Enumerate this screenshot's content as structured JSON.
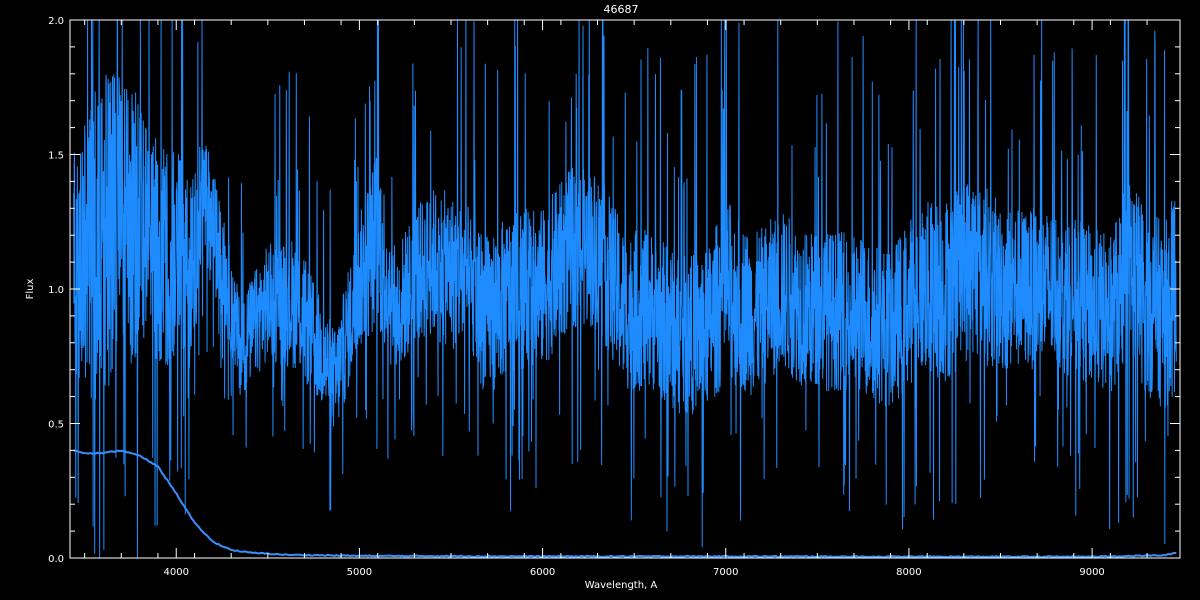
{
  "chart_data": {
    "type": "line",
    "title": "46687",
    "xlabel": "Wavelength, A",
    "ylabel": "Flux",
    "xlim": [
      3420,
      9480
    ],
    "ylim": [
      0.0,
      2.0
    ],
    "xticks": [
      4000,
      5000,
      6000,
      7000,
      8000,
      9000
    ],
    "xtick_labels": [
      "4000",
      "5000",
      "6000",
      "7000",
      "8000",
      "9000"
    ],
    "yticks": [
      0.0,
      0.5,
      1.0,
      1.5,
      2.0
    ],
    "ytick_labels": [
      "0.0",
      "0.5",
      "1.0",
      "1.5",
      "2.0"
    ],
    "grid": false,
    "background_color": "#000000",
    "axis_color": "#ffffff",
    "series": [
      {
        "color": "#1e8cff",
        "style": "noisy-spectrum",
        "x": [
          3440,
          3500,
          3600,
          3700,
          3800,
          3900,
          4000,
          4080,
          4150,
          4250,
          4350,
          4500,
          4650,
          4800,
          4870,
          5000,
          5100,
          5200,
          5300,
          5400,
          5550,
          5700,
          5850,
          6000,
          6150,
          6300,
          6450,
          6600,
          6750,
          6900,
          7000,
          7150,
          7300,
          7450,
          7600,
          7750,
          7900,
          8050,
          8200,
          8350,
          8500,
          8650,
          8800,
          8950,
          9100,
          9200,
          9300,
          9400,
          9460
        ],
        "y_mid": [
          1.1,
          1.1,
          1.2,
          1.25,
          1.22,
          1.15,
          1.12,
          1.05,
          1.35,
          1.1,
          0.78,
          0.95,
          0.95,
          0.75,
          0.65,
          1.02,
          1.2,
          0.9,
          1.05,
          1.1,
          1.05,
          0.9,
          1.0,
          1.0,
          1.15,
          1.15,
          0.92,
          0.92,
          0.82,
          0.85,
          1.0,
          0.9,
          1.0,
          0.92,
          0.92,
          0.9,
          0.85,
          1.0,
          1.0,
          1.1,
          1.0,
          1.0,
          1.0,
          0.95,
          0.9,
          1.1,
          0.95,
          0.9,
          1.0
        ],
        "y_amp": [
          0.45,
          0.55,
          0.6,
          0.55,
          0.5,
          0.45,
          0.4,
          0.35,
          0.25,
          0.2,
          0.18,
          0.22,
          0.25,
          0.2,
          0.2,
          0.25,
          0.35,
          0.25,
          0.25,
          0.28,
          0.3,
          0.3,
          0.3,
          0.3,
          0.3,
          0.3,
          0.3,
          0.3,
          0.3,
          0.3,
          0.35,
          0.3,
          0.3,
          0.3,
          0.3,
          0.3,
          0.3,
          0.32,
          0.35,
          0.35,
          0.32,
          0.3,
          0.3,
          0.3,
          0.3,
          0.35,
          0.35,
          0.35,
          0.4
        ]
      },
      {
        "color": "#3a8fff",
        "style": "smooth",
        "x": [
          3440,
          3500,
          3600,
          3700,
          3800,
          3900,
          4000,
          4100,
          4200,
          4300,
          4400,
          4600,
          5000,
          6000,
          7000,
          8000,
          9000,
          9400,
          9460
        ],
        "y": [
          0.4,
          0.39,
          0.39,
          0.4,
          0.38,
          0.34,
          0.24,
          0.13,
          0.06,
          0.03,
          0.02,
          0.012,
          0.008,
          0.006,
          0.006,
          0.005,
          0.005,
          0.01,
          0.02
        ]
      }
    ]
  }
}
